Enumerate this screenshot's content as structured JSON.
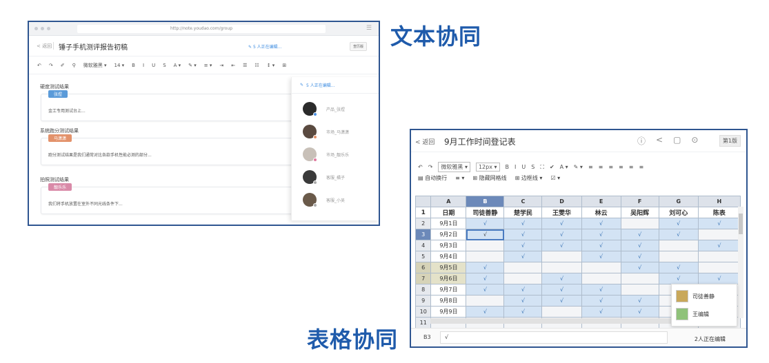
{
  "headings": {
    "text_collab": "文本协同",
    "sheet_collab": "表格协同"
  },
  "doc": {
    "url": "http://note.youdao.com/group",
    "back": "< 返回",
    "title": "锤子手机测评报告初稿",
    "editing": "5 人正在编辑...",
    "history_button": "查历版",
    "toolbar": [
      "↶",
      "↷",
      "✐",
      "⚲",
      "微软雅黑 ▾",
      "14 ▾",
      "B",
      "I",
      "U",
      "S",
      "A ▾",
      "✎ ▾",
      "≡ ▾",
      "⇥",
      "⇤",
      "☰",
      "☷",
      "↕ ▾",
      "⊞"
    ],
    "sections": [
      {
        "title": "硬度测试结果",
        "tag": "张煜",
        "tag_color": "#5b9bd9",
        "text": "金工专用测试台上..."
      },
      {
        "title": "系统跑分测试结果",
        "tag": "马潇潇",
        "tag_color": "#e3926b",
        "text": "跑分测试结果是我们通常对比各款手机性能必测的部分..."
      },
      {
        "title": "拍照测试结果",
        "tag": "靓乐乐",
        "tag_color": "#d98aa8",
        "text": "我们将手机放置在室外不同光线条件下..."
      }
    ],
    "panel": {
      "head": "5 人正在编辑...",
      "editors": [
        {
          "name": "产品_张煜",
          "dot": "#4a90e2",
          "avatar": "#2b2b2b"
        },
        {
          "name": "市场_马潇潇",
          "dot": "#e3926b",
          "avatar": "#5a4a40"
        },
        {
          "name": "市场_靓乐乐",
          "dot": "#e07aa0",
          "avatar": "#c8c0b8"
        },
        {
          "name": "客服_橘子",
          "dot": "#aaaaaa",
          "avatar": "#3a3a3a"
        },
        {
          "name": "客服_小吴",
          "dot": "#aaaaaa",
          "avatar": "#6a5a4a"
        }
      ]
    }
  },
  "sheet": {
    "back": "< 返回",
    "title": "9月工作时间登记表",
    "icons": [
      "ⓘ",
      "<",
      "▢",
      "⊙"
    ],
    "version": "第1版",
    "toolbar1": [
      "↶",
      "↷",
      "微软雅黑 ▾",
      "12px ▾",
      "B",
      "I",
      "U",
      "S",
      "⛶",
      "✔",
      "A ▾",
      "✎ ▾",
      "≡",
      "≡",
      "≡",
      "≡",
      "≡",
      "≡"
    ],
    "toolbar2": [
      "▤ 自动换行",
      "≡ ▾",
      "⊞ 隐藏网格线",
      "⊞ 边框线 ▾",
      "☑ ▾"
    ],
    "columns": [
      "A",
      "B",
      "C",
      "D",
      "E",
      "F",
      "G",
      "H"
    ],
    "header_row": [
      "日期",
      "司徒善静",
      "楚学民",
      "王雯华",
      "林云",
      "吴阳辉",
      "刘可心",
      "陈表"
    ],
    "rows": [
      {
        "n": "2",
        "date": "9月1日",
        "cells": [
          "√",
          "√",
          "√",
          "√",
          "",
          "√",
          "√"
        ]
      },
      {
        "n": "3",
        "date": "9月2日",
        "cells": [
          "√",
          "√",
          "√",
          "√",
          "√",
          "√",
          ""
        ]
      },
      {
        "n": "4",
        "date": "9月3日",
        "cells": [
          "",
          "√",
          "√",
          "√",
          "√",
          "",
          "√"
        ]
      },
      {
        "n": "5",
        "date": "9月4日",
        "cells": [
          "",
          "√",
          "",
          "√",
          "√",
          "",
          ""
        ]
      },
      {
        "n": "6",
        "date": "9月5日",
        "cells": [
          "√",
          "",
          "",
          "",
          "√",
          "√",
          ""
        ]
      },
      {
        "n": "7",
        "date": "9月6日",
        "cells": [
          "√",
          "",
          "√",
          "",
          "",
          "√",
          "√"
        ]
      },
      {
        "n": "8",
        "date": "9月7日",
        "cells": [
          "√",
          "√",
          "√",
          "√",
          "",
          "",
          ""
        ]
      },
      {
        "n": "9",
        "date": "9月8日",
        "cells": [
          "",
          "√",
          "√",
          "√",
          "√",
          "",
          ""
        ]
      },
      {
        "n": "10",
        "date": "9月9日",
        "cells": [
          "√",
          "√",
          "",
          "√",
          "√",
          "",
          ""
        ]
      }
    ],
    "last_row": "11",
    "cell_ref": "B3",
    "formula": "√",
    "editing_count": "2人正在编辑",
    "popup_users": [
      "司徒善静",
      "王编辑"
    ]
  }
}
